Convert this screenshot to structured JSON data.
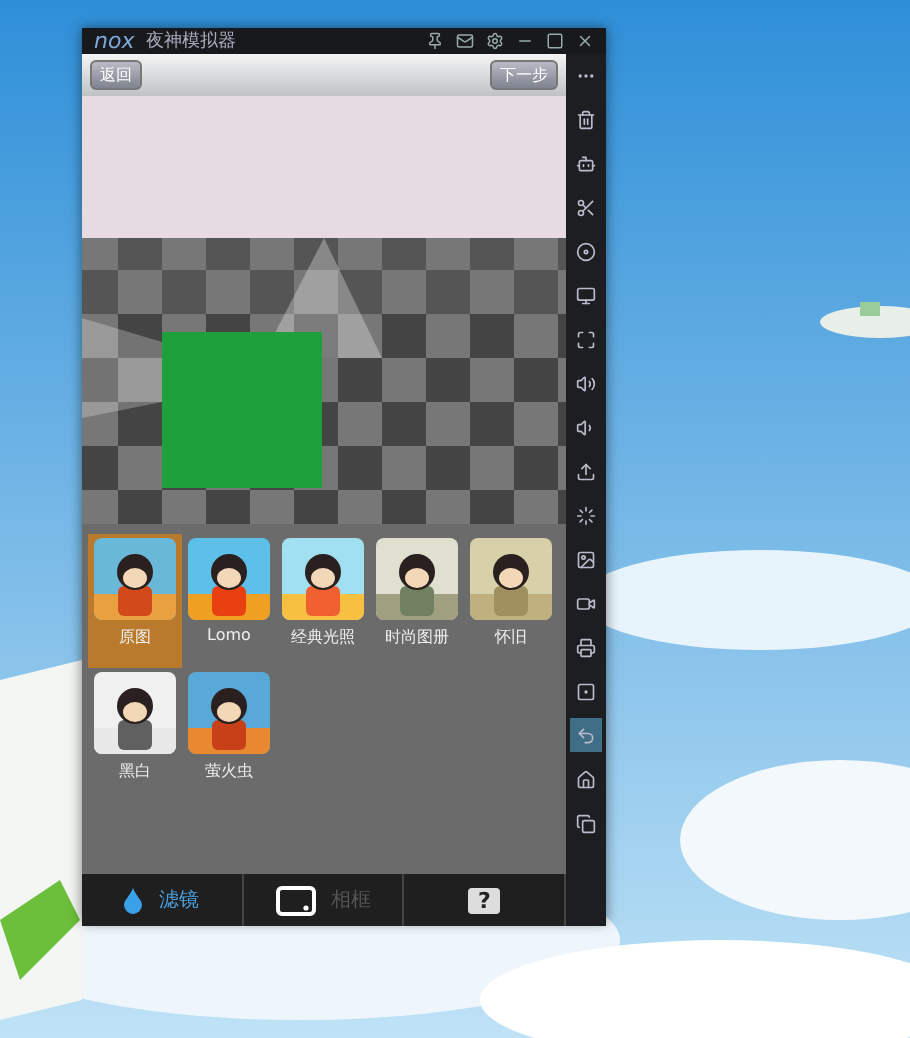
{
  "window": {
    "logo": "nox",
    "title": "夜神模拟器"
  },
  "toolbar": {
    "back": "返回",
    "next": "下一步"
  },
  "filters": [
    {
      "label": "原图",
      "selected": true
    },
    {
      "label": "Lomo",
      "selected": false
    },
    {
      "label": "经典光照",
      "selected": false
    },
    {
      "label": "时尚图册",
      "selected": false
    },
    {
      "label": "怀旧",
      "selected": false
    },
    {
      "label": "黑白",
      "selected": false
    },
    {
      "label": "萤火虫",
      "selected": false
    }
  ],
  "bottom_tabs": [
    {
      "kind": "filter",
      "label": "滤镜",
      "selected": true
    },
    {
      "kind": "frame",
      "label": "相框",
      "selected": false
    },
    {
      "kind": "help",
      "label": "?",
      "selected": false
    }
  ],
  "sidebar_items": [
    {
      "selected": false
    },
    {
      "selected": false
    },
    {
      "selected": false
    },
    {
      "selected": false
    },
    {
      "selected": false
    },
    {
      "selected": false
    },
    {
      "selected": false
    },
    {
      "selected": false
    },
    {
      "selected": false
    },
    {
      "selected": false
    },
    {
      "selected": false
    },
    {
      "selected": false
    },
    {
      "selected": false
    },
    {
      "selected": false
    },
    {
      "selected": false
    },
    {
      "selected": true
    },
    {
      "selected": false
    },
    {
      "selected": false
    }
  ]
}
